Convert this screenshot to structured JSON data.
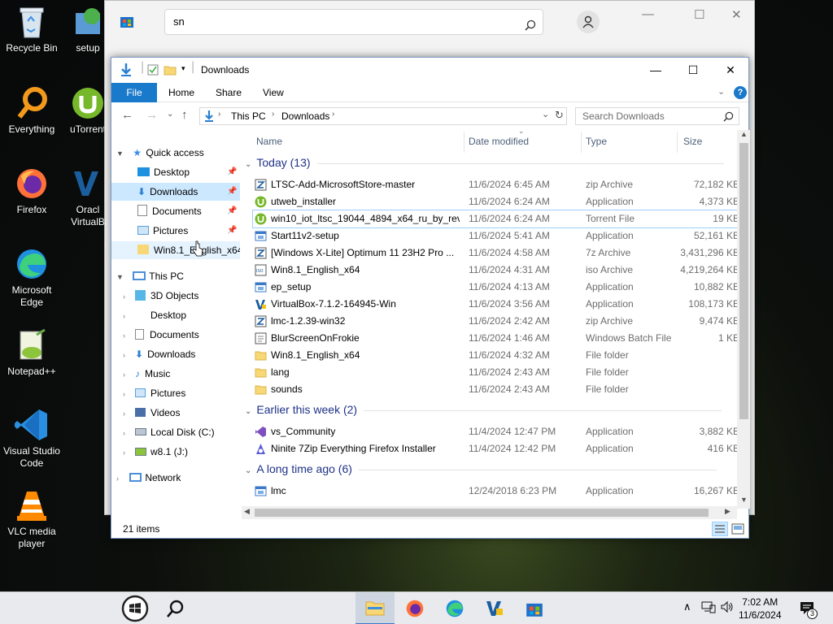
{
  "desktop": {
    "icons": [
      {
        "label": "Recycle Bin"
      },
      {
        "label": "Everything"
      },
      {
        "label": "Firefox"
      },
      {
        "label": "Microsoft Edge"
      },
      {
        "label": "Notepad++"
      },
      {
        "label": "Visual Studio Code"
      },
      {
        "label": "VLC media player"
      }
    ],
    "col2": [
      {
        "label": "setup"
      },
      {
        "label": "uTorrent"
      },
      {
        "label": "Oracl VirtualB"
      }
    ]
  },
  "store": {
    "search_value": "sn"
  },
  "explorer": {
    "title": "Downloads",
    "ribbon": {
      "file": "File",
      "home": "Home",
      "share": "Share",
      "view": "View"
    },
    "breadcrumb": [
      "This PC",
      "Downloads"
    ],
    "search_placeholder": "Search Downloads",
    "nav": {
      "quick_access": "Quick access",
      "quick_items": [
        "Desktop",
        "Downloads",
        "Documents",
        "Pictures",
        "Win8.1_English_x64"
      ],
      "this_pc": "This PC",
      "pc_items": [
        "3D Objects",
        "Desktop",
        "Documents",
        "Downloads",
        "Music",
        "Pictures",
        "Videos",
        "Local Disk (C:)",
        "w8.1 (J:)"
      ],
      "network": "Network"
    },
    "columns": {
      "name": "Name",
      "date": "Date modified",
      "type": "Type",
      "size": "Size"
    },
    "groups": [
      {
        "label": "Today (13)",
        "rows": [
          {
            "name": "LTSC-Add-MicrosoftStore-master",
            "date": "11/6/2024 6:45 AM",
            "type": "zip Archive",
            "size": "72,182 KB",
            "icon": "zip"
          },
          {
            "name": "utweb_installer",
            "date": "11/6/2024 6:24 AM",
            "type": "Application",
            "size": "4,373 KB",
            "icon": "utorrent"
          },
          {
            "name": "win10_iot_ltsc_19044_4894_x64_ru_by_rev...",
            "date": "11/6/2024 6:24 AM",
            "type": "Torrent File",
            "size": "19 KB",
            "icon": "utorrent"
          },
          {
            "name": "Start11v2-setup",
            "date": "11/6/2024 5:41 AM",
            "type": "Application",
            "size": "52,161 KB",
            "icon": "app"
          },
          {
            "name": "[Windows X-Lite] Optimum 11 23H2 Pro ...",
            "date": "11/6/2024 4:58 AM",
            "type": "7z Archive",
            "size": "3,431,296 KB",
            "icon": "zip"
          },
          {
            "name": "Win8.1_English_x64",
            "date": "11/6/2024 4:31 AM",
            "type": "iso Archive",
            "size": "4,219,264 KB",
            "icon": "iso"
          },
          {
            "name": "ep_setup",
            "date": "11/6/2024 4:13 AM",
            "type": "Application",
            "size": "10,882 KB",
            "icon": "app"
          },
          {
            "name": "VirtualBox-7.1.2-164945-Win",
            "date": "11/6/2024 3:56 AM",
            "type": "Application",
            "size": "108,173 KB",
            "icon": "vbox"
          },
          {
            "name": "lmc-1.2.39-win32",
            "date": "11/6/2024 2:42 AM",
            "type": "zip Archive",
            "size": "9,474 KB",
            "icon": "zip"
          },
          {
            "name": "BlurScreenOnFrokie",
            "date": "11/6/2024 1:46 AM",
            "type": "Windows Batch File",
            "size": "1 KB",
            "icon": "bat"
          },
          {
            "name": "Win8.1_English_x64",
            "date": "11/6/2024 4:32 AM",
            "type": "File folder",
            "size": "",
            "icon": "folder"
          },
          {
            "name": "lang",
            "date": "11/6/2024 2:43 AM",
            "type": "File folder",
            "size": "",
            "icon": "folder"
          },
          {
            "name": "sounds",
            "date": "11/6/2024 2:43 AM",
            "type": "File folder",
            "size": "",
            "icon": "folder"
          }
        ]
      },
      {
        "label": "Earlier this week (2)",
        "rows": [
          {
            "name": "vs_Community",
            "date": "11/4/2024 12:47 PM",
            "type": "Application",
            "size": "3,882 KB",
            "icon": "vs"
          },
          {
            "name": "Ninite 7Zip Everything Firefox Installer",
            "date": "11/4/2024 12:42 PM",
            "type": "Application",
            "size": "416 KB",
            "icon": "ninite"
          }
        ]
      },
      {
        "label": "A long time ago (6)",
        "rows": [
          {
            "name": "lmc",
            "date": "12/24/2018 6:23 PM",
            "type": "Application",
            "size": "16,267 KB",
            "icon": "app"
          }
        ]
      }
    ],
    "status": "21 items"
  },
  "taskbar": {
    "time": "7:02 AM",
    "date": "11/6/2024",
    "notification_count": "3"
  }
}
